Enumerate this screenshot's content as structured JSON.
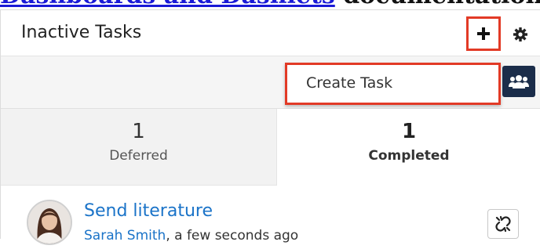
{
  "doc_header": {
    "link_text": "Dashboards and Dashlets",
    "rest_text": " documentation."
  },
  "dashlet": {
    "title": "Inactive Tasks",
    "create_menu_label": "Create Task",
    "tabs": [
      {
        "count": "1",
        "label": "Deferred",
        "active": false
      },
      {
        "count": "1",
        "label": "Completed",
        "active": true
      }
    ],
    "tasks": [
      {
        "title": "Send literature",
        "assigned_user": "Sarah Smith",
        "time": ", a few seconds ago"
      }
    ]
  },
  "colors": {
    "highlight": "#e23a26",
    "link": "#1a73c8",
    "button_dark": "#1b2d4a"
  },
  "icons": {
    "plus": "plus-icon",
    "gear": "gear-icon",
    "users": "users-icon",
    "unlink": "unlink-icon",
    "avatar": "avatar"
  }
}
